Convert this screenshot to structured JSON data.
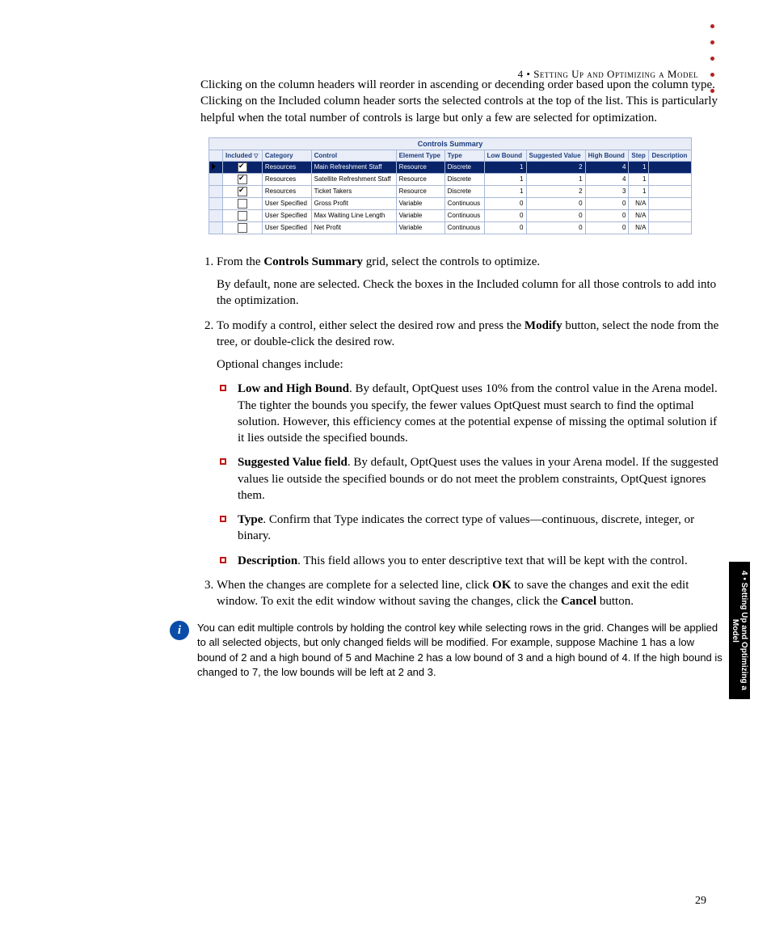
{
  "header": {
    "chapter_ref": "4 • Setting Up and Optimizing a Model"
  },
  "intro": "Clicking on the column headers will reorder in ascending or decending order based upon the column type. Clicking on the Included column header sorts the selected controls at the top of the list. This is particularly helpful when the total number of controls is large but only a few are selected for optimization.",
  "table": {
    "title": "Controls Summary",
    "columns": [
      "Included",
      "Category",
      "Control",
      "Element Type",
      "Type",
      "Low Bound",
      "Suggested Value",
      "High Bound",
      "Step",
      "Description"
    ],
    "rows": [
      {
        "selected": true,
        "included": true,
        "category": "Resources",
        "control": "Main Refreshment Staff",
        "element_type": "Resource",
        "type": "Discrete",
        "low": "1",
        "sugg": "2",
        "high": "4",
        "step": "1",
        "desc": ""
      },
      {
        "selected": false,
        "included": true,
        "category": "Resources",
        "control": "Satellite Refreshment Staff",
        "element_type": "Resource",
        "type": "Discrete",
        "low": "1",
        "sugg": "1",
        "high": "4",
        "step": "1",
        "desc": ""
      },
      {
        "selected": false,
        "included": true,
        "category": "Resources",
        "control": "Ticket Takers",
        "element_type": "Resource",
        "type": "Discrete",
        "low": "1",
        "sugg": "2",
        "high": "3",
        "step": "1",
        "desc": ""
      },
      {
        "selected": false,
        "included": false,
        "category": "User Specified",
        "control": "Gross Profit",
        "element_type": "Variable",
        "type": "Continuous",
        "low": "0",
        "sugg": "0",
        "high": "0",
        "step": "N/A",
        "desc": ""
      },
      {
        "selected": false,
        "included": false,
        "category": "User Specified",
        "control": "Max Waiting Line Length",
        "element_type": "Variable",
        "type": "Continuous",
        "low": "0",
        "sugg": "0",
        "high": "0",
        "step": "N/A",
        "desc": ""
      },
      {
        "selected": false,
        "included": false,
        "category": "User Specified",
        "control": "Net Profit",
        "element_type": "Variable",
        "type": "Continuous",
        "low": "0",
        "sugg": "0",
        "high": "0",
        "step": "N/A",
        "desc": ""
      }
    ]
  },
  "steps": {
    "s1_lead": "From the ",
    "s1_bold": "Controls Summary",
    "s1_tail": " grid, select the controls to optimize.",
    "s1_p": "By default, none are selected. Check the boxes in the Included column for all those controls to add into the optimization.",
    "s2_lead": "To modify a control, either select the desired row and press the ",
    "s2_bold": "Modify",
    "s2_tail": " button, select the node from the tree, or double-click the desired row.",
    "s2_p": "Optional changes include:",
    "bullets": {
      "b1_bold": "Low and High Bound",
      "b1_text": ". By default, OptQuest uses 10% from the control value in the Arena model. The tighter the bounds you specify, the fewer values OptQuest must search to find the optimal solution. However, this efficiency comes at the potential expense of missing the optimal solution if it lies outside the specified bounds.",
      "b2_bold": "Suggested Value field",
      "b2_text": ". By default, OptQuest uses the values in your Arena model. If the suggested values lie outside the specified bounds or do not meet the problem constraints, OptQuest ignores them.",
      "b3_bold": "Type",
      "b3_text": ". Confirm that Type indicates the correct type of values—continuous, discrete, integer, or binary.",
      "b4_bold": "Description",
      "b4_text": ". This field allows you to enter descriptive text that will be kept with the control."
    },
    "s3_lead": "When the changes are complete for a selected line, click ",
    "s3_bold1": "OK",
    "s3_mid": " to save the changes and exit the edit window. To exit the edit window without saving the changes, click the ",
    "s3_bold2": "Cancel",
    "s3_tail": " button."
  },
  "note": {
    "glyph": "i",
    "text": "You can edit multiple controls by holding the control key while selecting rows in the grid. Changes will be applied to all selected objects, but only changed fields will be modified. For example, suppose Machine 1 has a low bound of 2 and a high bound of 5 and Machine 2 has a low bound of 3 and a high bound of 4. If the high bound is changed to 7, the low bounds will be left at 2 and 3."
  },
  "side_tab": "4 • Setting Up and Optimizing a Model",
  "page_number": "29"
}
